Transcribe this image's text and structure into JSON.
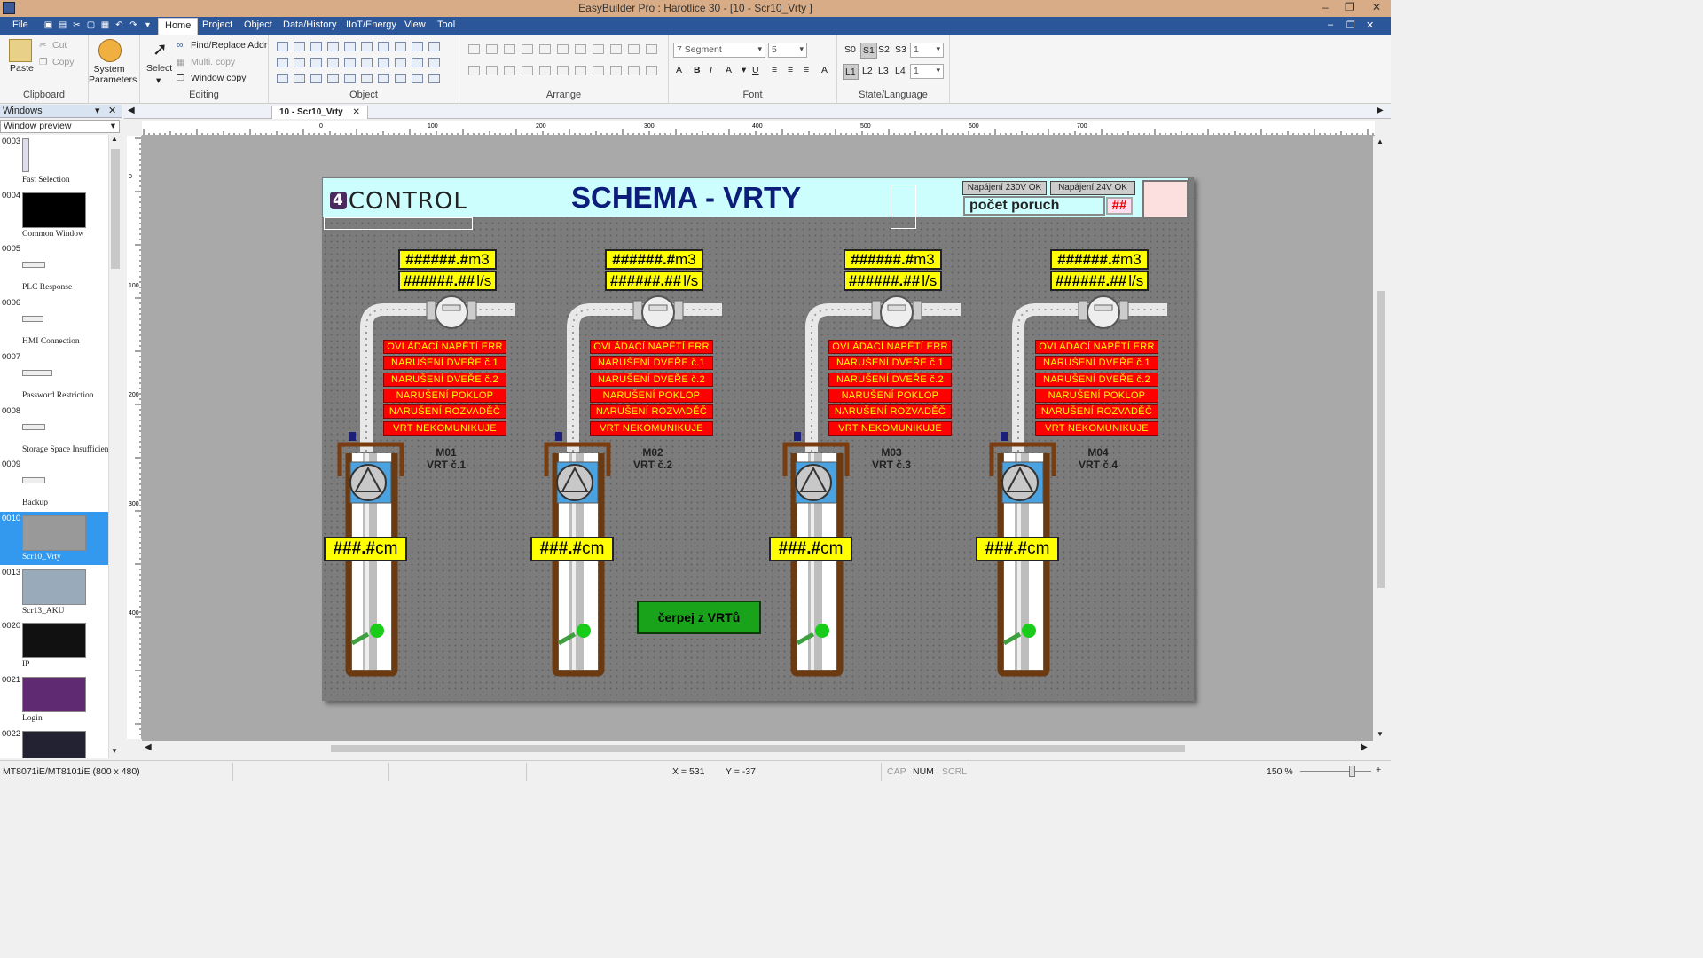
{
  "window": {
    "title": "EasyBuilder Pro : Harotlice 30 - [10 - Scr10_Vrty ]"
  },
  "menu": {
    "items": [
      "File",
      "Home",
      "Project",
      "Object",
      "Data/History",
      "IIoT/Energy",
      "View",
      "Tool"
    ],
    "active": "Home"
  },
  "ribbon": {
    "clipboard": {
      "label": "Clipboard",
      "paste": "Paste",
      "cut": "Cut",
      "copy": "Copy"
    },
    "system": {
      "label": "System Parameters"
    },
    "editing": {
      "label": "Editing",
      "select": "Select",
      "find_replace": "Find/Replace Addr",
      "multi_copy": "Multi. copy",
      "window_copy": "Window copy"
    },
    "object": {
      "label": "Object"
    },
    "arrange": {
      "label": "Arrange"
    },
    "font": {
      "label": "Font",
      "family": "7 Segment",
      "size": "5"
    },
    "state": {
      "label": "State/Language",
      "s0": "S0",
      "s1": "S1",
      "s2": "S2",
      "s3": "S3",
      "state_val": "1",
      "l1": "L1",
      "l2": "L2",
      "l3": "L3",
      "l4": "L4",
      "lang_val": "1"
    }
  },
  "panel": {
    "title": "Windows",
    "mode": "Window preview",
    "items": [
      {
        "num": "0003",
        "name": "Fast Selection"
      },
      {
        "num": "0004",
        "name": "Common Window"
      },
      {
        "num": "0005",
        "name": "PLC Response"
      },
      {
        "num": "0006",
        "name": "HMI Connection"
      },
      {
        "num": "0007",
        "name": "Password Restriction"
      },
      {
        "num": "0008",
        "name": "Storage Space Insufficient"
      },
      {
        "num": "0009",
        "name": "Backup"
      },
      {
        "num": "0010",
        "name": "Scr10_Vrty"
      },
      {
        "num": "0013",
        "name": "Scr13_AKU"
      },
      {
        "num": "0020",
        "name": "IP"
      },
      {
        "num": "0021",
        "name": "Login"
      },
      {
        "num": "0022",
        "name": ""
      }
    ]
  },
  "tab": {
    "label": "10 - Scr10_Vrty"
  },
  "ruler": {
    "h": [
      "0",
      "100",
      "200",
      "300",
      "400",
      "500",
      "600",
      "700"
    ],
    "v": [
      "0",
      "100",
      "200",
      "300",
      "400"
    ]
  },
  "hmi": {
    "logo_badge": "4",
    "logo_text": "CONTROL",
    "title": "SCHEMA - VRTY",
    "pwr230": "Napájení 230V OK",
    "pwr24": "Napájení 24V OK",
    "faults_label": "počet poruch",
    "faults_value": "##",
    "button": "čerpej z VRTů",
    "alarms": [
      "OVLÁDACÍ NAPĚTÍ ERR",
      "NARUŠENÍ DVEŘE č.1",
      "NARUŠENÍ DVEŘE č.2",
      "NARUŠENÍ POKLOP",
      "NARUŠENÍ ROZVADĚČ",
      "VRT NEKOMUNIKUJE"
    ],
    "wells": [
      {
        "id": "M01",
        "name": "VRT č.1",
        "volume": "######.#",
        "volume_unit": "m3",
        "flow": "######.##",
        "flow_unit": "l/s",
        "level": "###.#",
        "level_unit": "cm"
      },
      {
        "id": "M02",
        "name": "VRT č.2",
        "volume": "######.#",
        "volume_unit": "m3",
        "flow": "######.##",
        "flow_unit": "l/s",
        "level": "###.#",
        "level_unit": "cm"
      },
      {
        "id": "M03",
        "name": "VRT č.3",
        "volume": "######.#",
        "volume_unit": "m3",
        "flow": "######.##",
        "flow_unit": "l/s",
        "level": "###.#",
        "level_unit": "cm"
      },
      {
        "id": "M04",
        "name": "VRT č.4",
        "volume": "######.#",
        "volume_unit": "m3",
        "flow": "######.##",
        "flow_unit": "l/s",
        "level": "###.#",
        "level_unit": "cm"
      }
    ]
  },
  "status": {
    "model": "MT8071iE/MT8101iE (800 x 480)",
    "x": "X = 531",
    "y": "Y = -37",
    "cap": "CAP",
    "num": "NUM",
    "scrl": "SCRL",
    "zoom": "150 %"
  },
  "colors": {
    "accent": "#2b579a",
    "hmi_bg": "#7c7c7c",
    "header": "#ccfefe",
    "alarm": "#ff0000",
    "display": "#ffff00",
    "pump_button": "#19a31a"
  }
}
